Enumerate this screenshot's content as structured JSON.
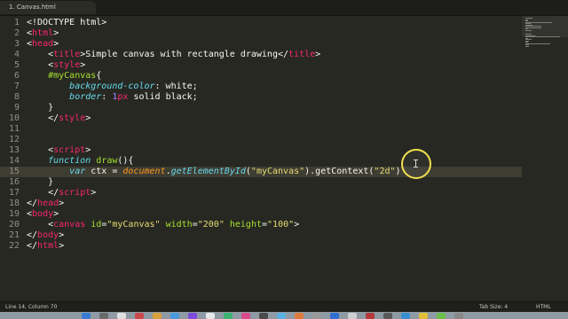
{
  "tab": {
    "title": "1. Canvas.html"
  },
  "editor": {
    "lines": [
      {
        "n": "1",
        "parts": [
          {
            "t": "<!DOCTYPE html>",
            "c": "t-text"
          }
        ]
      },
      {
        "n": "2",
        "parts": [
          {
            "t": "<",
            "c": "t-text"
          },
          {
            "t": "html",
            "c": "t-tag"
          },
          {
            "t": ">",
            "c": "t-text"
          }
        ]
      },
      {
        "n": "3",
        "parts": [
          {
            "t": "<",
            "c": "t-text"
          },
          {
            "t": "head",
            "c": "t-tag"
          },
          {
            "t": ">",
            "c": "t-text"
          }
        ]
      },
      {
        "n": "4",
        "parts": [
          {
            "t": "    <",
            "c": "t-text"
          },
          {
            "t": "title",
            "c": "t-tag"
          },
          {
            "t": ">Simple canvas with rectangle drawing</",
            "c": "t-text"
          },
          {
            "t": "title",
            "c": "t-tag"
          },
          {
            "t": ">",
            "c": "t-text"
          }
        ]
      },
      {
        "n": "5",
        "parts": [
          {
            "t": "    <",
            "c": "t-text"
          },
          {
            "t": "style",
            "c": "t-tag"
          },
          {
            "t": ">",
            "c": "t-text"
          }
        ]
      },
      {
        "n": "6",
        "parts": [
          {
            "t": "    ",
            "c": "t-text"
          },
          {
            "t": "#myCanvas",
            "c": "t-sel"
          },
          {
            "t": "{",
            "c": "t-text"
          }
        ]
      },
      {
        "n": "7",
        "parts": [
          {
            "t": "        ",
            "c": "t-text"
          },
          {
            "t": "background-color",
            "c": "t-prop"
          },
          {
            "t": ": ",
            "c": "t-text"
          },
          {
            "t": "white",
            "c": "t-text"
          },
          {
            "t": ";",
            "c": "t-text"
          }
        ]
      },
      {
        "n": "8",
        "parts": [
          {
            "t": "        ",
            "c": "t-text"
          },
          {
            "t": "border",
            "c": "t-prop"
          },
          {
            "t": ": ",
            "c": "t-text"
          },
          {
            "t": "1",
            "c": "t-val"
          },
          {
            "t": "px",
            "c": "t-tag"
          },
          {
            "t": " solid black;",
            "c": "t-text"
          }
        ]
      },
      {
        "n": "9",
        "parts": [
          {
            "t": "    }",
            "c": "t-text"
          }
        ]
      },
      {
        "n": "10",
        "parts": [
          {
            "t": "    </",
            "c": "t-text"
          },
          {
            "t": "style",
            "c": "t-tag"
          },
          {
            "t": ">",
            "c": "t-text"
          }
        ]
      },
      {
        "n": "11",
        "parts": [
          {
            "t": "",
            "c": "t-text"
          }
        ]
      },
      {
        "n": "12",
        "parts": [
          {
            "t": "",
            "c": "t-text"
          }
        ]
      },
      {
        "n": "13",
        "parts": [
          {
            "t": "    <",
            "c": "t-text"
          },
          {
            "t": "script",
            "c": "t-tag"
          },
          {
            "t": ">",
            "c": "t-text"
          }
        ]
      },
      {
        "n": "14",
        "parts": [
          {
            "t": "    ",
            "c": "t-text"
          },
          {
            "t": "function",
            "c": "t-kw"
          },
          {
            "t": " ",
            "c": "t-text"
          },
          {
            "t": "draw",
            "c": "t-fn"
          },
          {
            "t": "(){",
            "c": "t-text"
          }
        ]
      },
      {
        "n": "15",
        "parts": [
          {
            "t": "        ",
            "c": "t-text"
          },
          {
            "t": "var",
            "c": "t-kw"
          },
          {
            "t": " ctx = ",
            "c": "t-text"
          },
          {
            "t": "document",
            "c": "t-var"
          },
          {
            "t": ".",
            "c": "t-text"
          },
          {
            "t": "getElementById",
            "c": "t-prop"
          },
          {
            "t": "(",
            "c": "t-text"
          },
          {
            "t": "\"myCanvas\"",
            "c": "t-str"
          },
          {
            "t": ").getContext(",
            "c": "t-text"
          },
          {
            "t": "\"2d\"",
            "c": "t-str"
          },
          {
            "t": ")",
            "c": "t-text"
          }
        ]
      },
      {
        "n": "16",
        "parts": [
          {
            "t": "    }",
            "c": "t-text"
          }
        ]
      },
      {
        "n": "17",
        "parts": [
          {
            "t": "    </",
            "c": "t-text"
          },
          {
            "t": "script",
            "c": "t-tag"
          },
          {
            "t": ">",
            "c": "t-text"
          }
        ]
      },
      {
        "n": "18",
        "parts": [
          {
            "t": "</",
            "c": "t-text"
          },
          {
            "t": "head",
            "c": "t-tag"
          },
          {
            "t": ">",
            "c": "t-text"
          }
        ]
      },
      {
        "n": "19",
        "parts": [
          {
            "t": "<",
            "c": "t-text"
          },
          {
            "t": "body",
            "c": "t-tag"
          },
          {
            "t": ">",
            "c": "t-text"
          }
        ]
      },
      {
        "n": "20",
        "parts": [
          {
            "t": "    <",
            "c": "t-text"
          },
          {
            "t": "canvas",
            "c": "t-tag"
          },
          {
            "t": " ",
            "c": "t-text"
          },
          {
            "t": "id",
            "c": "t-attr"
          },
          {
            "t": "=",
            "c": "t-text"
          },
          {
            "t": "\"myCanvas\"",
            "c": "t-str"
          },
          {
            "t": " ",
            "c": "t-text"
          },
          {
            "t": "width",
            "c": "t-attr"
          },
          {
            "t": "=",
            "c": "t-text"
          },
          {
            "t": "\"200\"",
            "c": "t-str"
          },
          {
            "t": " ",
            "c": "t-text"
          },
          {
            "t": "height",
            "c": "t-attr"
          },
          {
            "t": "=",
            "c": "t-text"
          },
          {
            "t": "\"100\"",
            "c": "t-str"
          },
          {
            "t": ">",
            "c": "t-text"
          }
        ]
      },
      {
        "n": "21",
        "parts": [
          {
            "t": "</",
            "c": "t-text"
          },
          {
            "t": "body",
            "c": "t-tag"
          },
          {
            "t": ">",
            "c": "t-text"
          }
        ]
      },
      {
        "n": "22",
        "parts": [
          {
            "t": "</",
            "c": "t-text"
          },
          {
            "t": "html",
            "c": "t-tag"
          },
          {
            "t": ">",
            "c": "t-text"
          }
        ]
      }
    ]
  },
  "status": {
    "position": "Line 14, Column 70",
    "tab_size": "Tab Size: 4",
    "syntax": "HTML"
  },
  "colors": {
    "background": "#272822",
    "tag": "#f92672",
    "string": "#e6db74",
    "attribute": "#a6e22e",
    "keyword": "#66d9ef",
    "number": "#ae81ff",
    "cursor_ring": "#f3e14f"
  }
}
